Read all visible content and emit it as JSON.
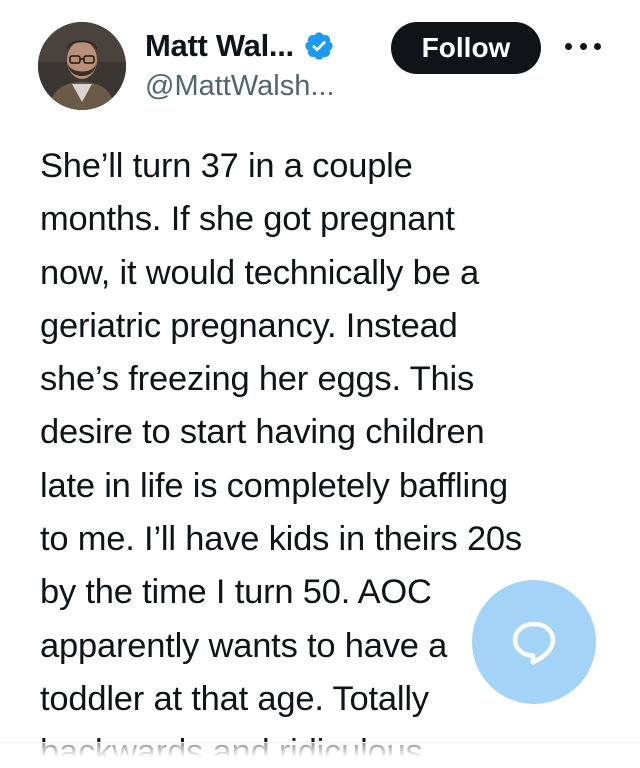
{
  "author": {
    "display_name": "Matt Wal...",
    "handle": "@MattWalsh...",
    "verified_icon": "verified-badge-icon",
    "avatar": "profile-photo"
  },
  "actions": {
    "follow_label": "Follow",
    "more_icon": "more-options-icon",
    "reply_icon": "reply-bubble-icon"
  },
  "tweet": {
    "text": "She’ll turn 37 in a couple\nmonths. If she got pregnant\nnow, it would technically be a\ngeriatric pregnancy. Instead\nshe’s freezing her eggs. This\ndesire to start having children\nlate in life is completely baffling\nto me. I’ll have kids in theirs 20s\nby the time I turn 50. AOC\napparently wants to have a\ntoddler at that age. Totally\nbackwards and ridiculous."
  },
  "colors": {
    "verified_blue": "#1d9bf0",
    "follow_bg": "#0f1419",
    "text_primary": "#0f1419",
    "text_secondary": "#536471",
    "fab_bg": "#78bff4"
  }
}
